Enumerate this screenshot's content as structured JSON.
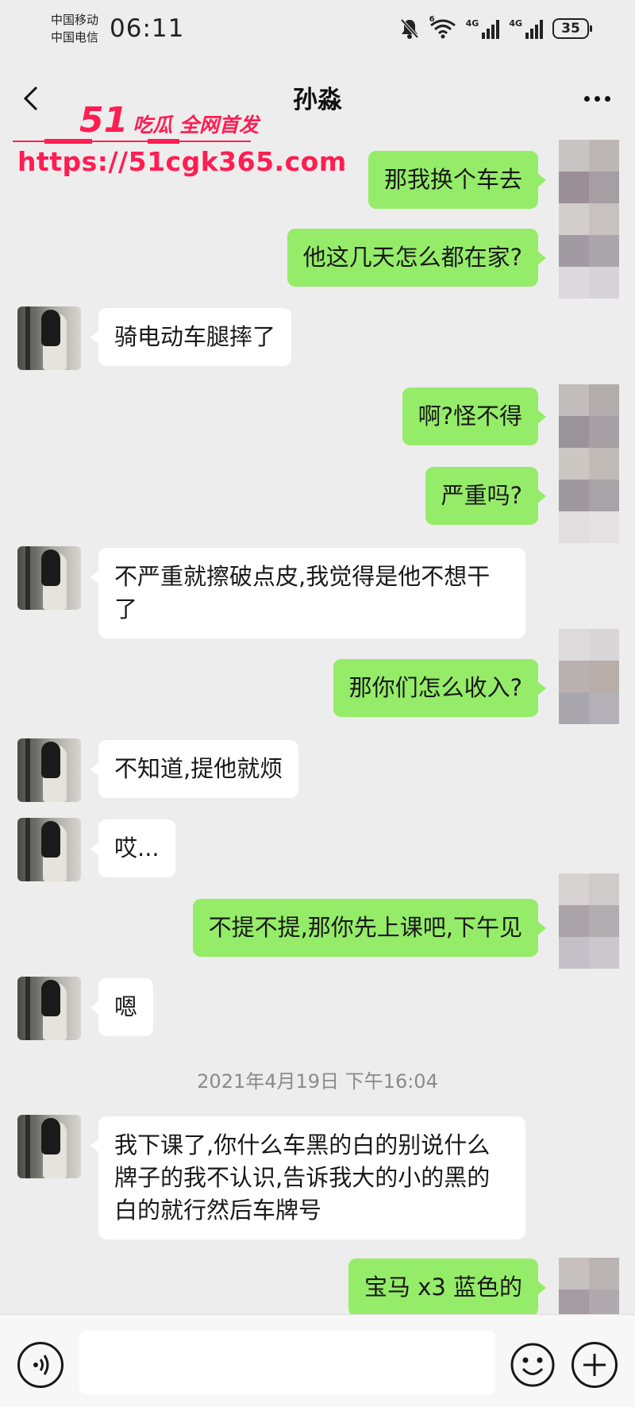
{
  "status_bar": {
    "carrier_1": "中国移动",
    "carrier_2": "中国电信",
    "time": "06:11",
    "wifi_tag": "6",
    "signal_1_tag": "4G",
    "signal_2_tag": "4G",
    "battery": "35"
  },
  "header": {
    "title": "孙淼",
    "back_icon": "chevron-left-icon",
    "more_icon": "ellipsis-icon"
  },
  "watermark": {
    "number": "51",
    "brand": "吃瓜 全网首发",
    "url": "https://51cgk365.com"
  },
  "messages": [
    {
      "side": "out",
      "text": "那我换个车去"
    },
    {
      "side": "out",
      "text": "他这几天怎么都在家?"
    },
    {
      "side": "in",
      "text": "骑电动车腿摔了"
    },
    {
      "side": "out",
      "text": "啊?怪不得"
    },
    {
      "side": "out",
      "text": "严重吗?"
    },
    {
      "side": "in",
      "text": "不严重就擦破点皮,我觉得是他不想干了"
    },
    {
      "side": "out",
      "text": "那你们怎么收入?"
    },
    {
      "side": "in",
      "text": "不知道,提他就烦"
    },
    {
      "side": "in",
      "text": "哎..."
    },
    {
      "side": "out",
      "text": "不提不提,那你先上课吧,下午见"
    },
    {
      "side": "in",
      "text": "嗯"
    },
    {
      "side": "in",
      "text": "我下课了,你什么车黑的白的别说什么牌子的我不认识,告诉我大的小的黑的白的就行然后车牌号"
    },
    {
      "side": "out",
      "text": "宝马 x3 蓝色的"
    }
  ],
  "timestamp": "2021年4月19日 下午16:04",
  "input_bar": {
    "voice_icon": "voice-icon",
    "emoji_icon": "emoji-icon",
    "plus_icon": "plus-icon",
    "placeholder": ""
  },
  "colors": {
    "outgoing_bubble": "#95ec69",
    "incoming_bubble": "#ffffff",
    "background": "#ededed",
    "watermark": "#ff1d52"
  }
}
